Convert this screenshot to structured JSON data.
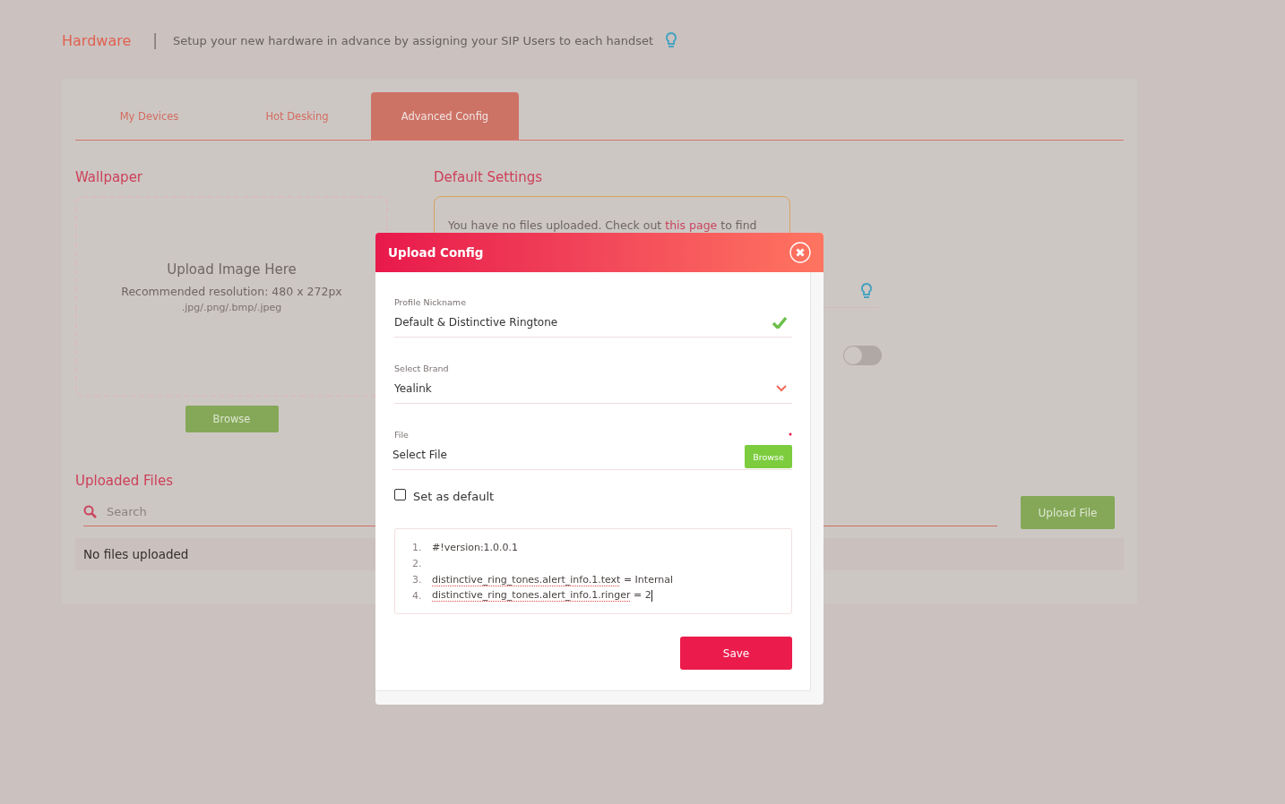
{
  "header": {
    "title": "Hardware",
    "separator": "|",
    "subtitle": "Setup your new hardware in advance by assigning your SIP Users to each handset"
  },
  "tabs": [
    {
      "label": "My Devices",
      "selected": false
    },
    {
      "label": "Hot Desking",
      "selected": false
    },
    {
      "label": "Advanced Config",
      "selected": true
    }
  ],
  "wallpaper": {
    "title": "Wallpaper",
    "upload_title": "Upload Image Here",
    "resolution": "Recommended resolution: 480 x 272px",
    "formats": ".jpg/.png/.bmp/.jpeg",
    "button": "Browse"
  },
  "default_settings": {
    "title": "Default Settings",
    "notice_before": "You have no files uploaded.  Check out ",
    "notice_link": "this page",
    "notice_after": " to find",
    "toggle": {
      "on": false
    }
  },
  "uploaded_files": {
    "title": "Uploaded Files",
    "search_placeholder": "Search",
    "empty_text": "No files uploaded",
    "upload_button": "Upload File"
  },
  "modal": {
    "title": "Upload Config",
    "fields": [
      {
        "kind": "text",
        "label": "Profile Nickname",
        "value": "Default & Distinctive Ringtone",
        "valid": true
      },
      {
        "kind": "select",
        "label": "Select Brand",
        "value": "Yealink"
      },
      {
        "kind": "file",
        "label": "File",
        "value": "Select File",
        "required": true,
        "button": "Browse"
      }
    ],
    "checkbox": {
      "label": "Set as default",
      "checked": false
    },
    "code_lines": [
      {
        "number": "1.",
        "key": "#!version:1.0.0.1",
        "misspelled": false,
        "cursor": false
      },
      {
        "number": "2.",
        "misspelled": false,
        "cursor": false
      },
      {
        "number": "3.",
        "key": "distinctive_ring_tones.alert_info.1.text",
        "value": "= Internal",
        "misspelled": true,
        "cursor": false
      },
      {
        "number": "4.",
        "key": "distinctive_ring_tones.alert_info.1.ringer",
        "value": "= 2",
        "misspelled": true,
        "cursor": true
      }
    ],
    "save_button": "Save"
  }
}
